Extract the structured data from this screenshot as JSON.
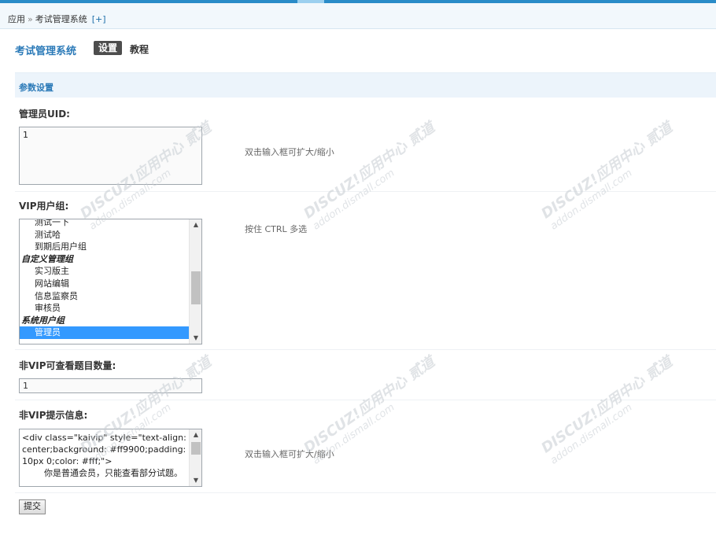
{
  "breadcrumb": {
    "root": "应用",
    "separator": "»",
    "current": "考试管理系统",
    "add": "[+]"
  },
  "app": {
    "title": "考试管理系统",
    "tabs": [
      {
        "label": "设置",
        "active": true
      },
      {
        "label": "教程",
        "active": false
      }
    ]
  },
  "section": {
    "title": "参数设置"
  },
  "fields": {
    "admin_uid": {
      "label": "管理员UID:",
      "value": "1",
      "hint": "双击输入框可扩大/缩小"
    },
    "vip_groups": {
      "label": "VIP用户组:",
      "hint": "按住 CTRL 多选",
      "options": [
        {
          "text": "测试一下",
          "type": "item"
        },
        {
          "text": "测试哈",
          "type": "item"
        },
        {
          "text": "到期后用户组",
          "type": "item"
        },
        {
          "text": "自定义管理组",
          "type": "group"
        },
        {
          "text": "实习版主",
          "type": "item"
        },
        {
          "text": "网站编辑",
          "type": "item"
        },
        {
          "text": "信息监察员",
          "type": "item"
        },
        {
          "text": "审核员",
          "type": "item"
        },
        {
          "text": "系统用户组",
          "type": "group"
        },
        {
          "text": "管理员",
          "type": "item",
          "selected": true
        }
      ]
    },
    "nonvip_count": {
      "label": "非VIP可查看题目数量:",
      "value": "1"
    },
    "nonvip_message": {
      "label": "非VIP提示信息:",
      "value": "<div class=\"kaivip\" style=\"text-align: center;background: #ff9900;padding: 10px 0;color: #fff;\">\n        你是普通会员，只能查看部分试题。",
      "hint": "双击输入框可扩大/缩小"
    }
  },
  "submit": {
    "label": "提交"
  },
  "watermark": {
    "brand": "DISCUZ!应用中心",
    "sub": "addon.dismall.com",
    "name": "贰道"
  },
  "colors": {
    "accent": "#2b7ab8",
    "top_bar": "#2a8cc8",
    "selected": "#3399ff"
  }
}
